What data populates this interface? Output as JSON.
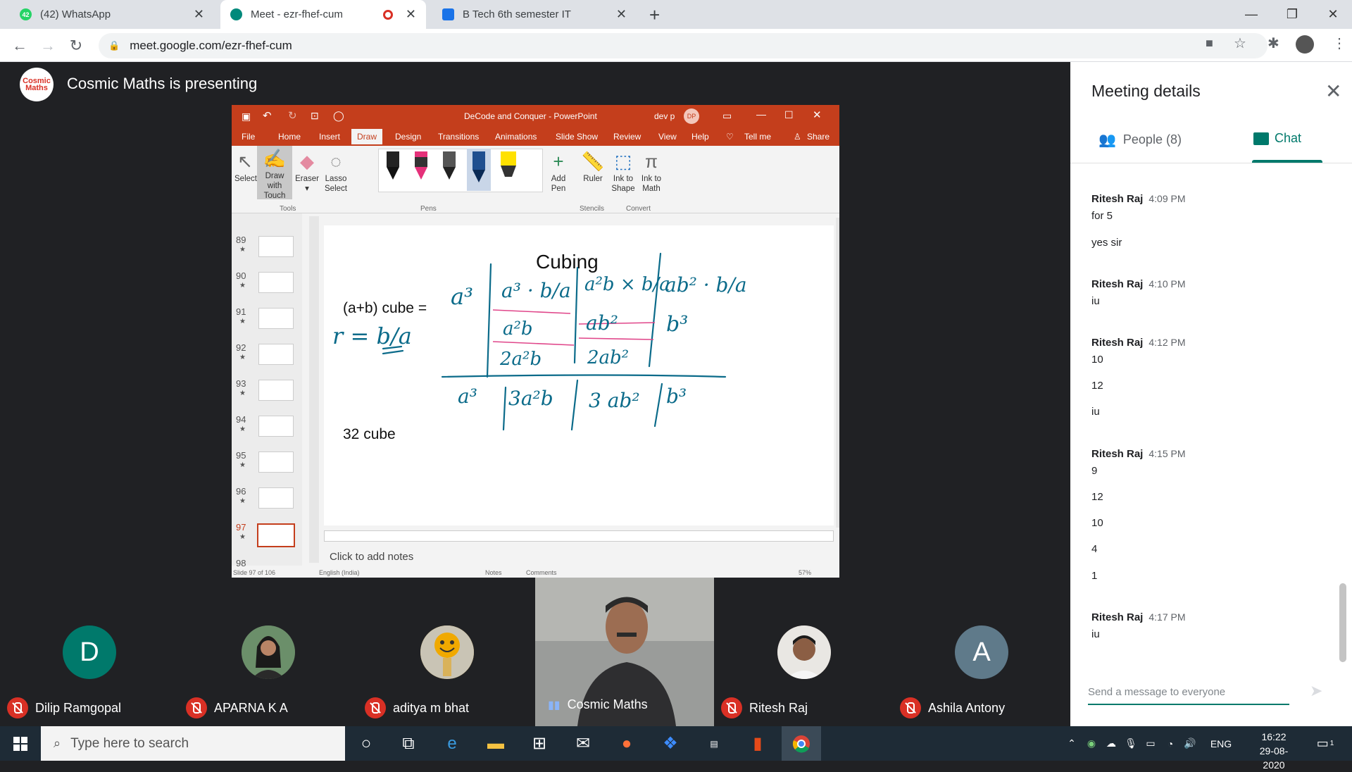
{
  "browser": {
    "tabs": [
      {
        "title": "(42) WhatsApp",
        "badge": "42",
        "active": false
      },
      {
        "title": "Meet - ezr-fhef-cum",
        "active": true
      },
      {
        "title": "B Tech 6th semester IT",
        "active": false
      }
    ],
    "url": "meet.google.com/ezr-fhef-cum"
  },
  "meet": {
    "presenter_logo": "Cosmic Maths",
    "presenting_label": "Cosmic Maths is presenting",
    "panel": {
      "title": "Meeting details",
      "people_tab": "People (8)",
      "chat_tab": "Chat",
      "messages": [
        {
          "name": "Ritesh Raj",
          "time": "4:09 PM",
          "lines": [
            "for 5",
            "yes sir"
          ]
        },
        {
          "name": "Ritesh Raj",
          "time": "4:10 PM",
          "lines": [
            "iu"
          ]
        },
        {
          "name": "Ritesh Raj",
          "time": "4:12 PM",
          "lines": [
            "10",
            "12",
            "iu"
          ]
        },
        {
          "name": "Ritesh Raj",
          "time": "4:15 PM",
          "lines": [
            "9",
            "12",
            "10",
            "4",
            "1"
          ]
        },
        {
          "name": "Ritesh Raj",
          "time": "4:17 PM",
          "lines": [
            "iu"
          ]
        }
      ],
      "send_placeholder": "Send a message to everyone"
    },
    "participants": [
      {
        "name": "Dilip Ramgopal",
        "initial": "D",
        "muted": true,
        "color": "#00796b"
      },
      {
        "name": "APARNA K A",
        "initial": "",
        "muted": true,
        "color": "#3a3a3a"
      },
      {
        "name": "aditya m bhat",
        "initial": "",
        "muted": true,
        "color": "#d4a017"
      },
      {
        "name": "Cosmic Maths",
        "initial": "",
        "muted": false,
        "color": "#8a8d90"
      },
      {
        "name": "Ritesh Raj",
        "initial": "",
        "muted": true,
        "color": "#6d5a4a"
      },
      {
        "name": "Ashila Antony",
        "initial": "A",
        "muted": true,
        "color": "#5f7a8a"
      }
    ]
  },
  "ppt": {
    "title": "DeCode and Conquer  -  PowerPoint",
    "user": "dev p",
    "user_initials": "DP",
    "tabs": [
      "File",
      "Home",
      "Insert",
      "Draw",
      "Design",
      "Transitions",
      "Animations",
      "Slide Show",
      "Review",
      "View",
      "Help",
      "Tell me",
      "Share"
    ],
    "tools": {
      "select": "Select",
      "draw_touch_1": "Draw with",
      "draw_touch_2": "Touch",
      "eraser": "Eraser",
      "lasso_1": "Lasso",
      "lasso_2": "Select",
      "group": "Tools"
    },
    "pens_group": "Pens",
    "add_pen_1": "Add",
    "add_pen_2": "Pen",
    "ruler": "Ruler",
    "stencils_group": "Stencils",
    "ink_shape_1": "Ink to",
    "ink_shape_2": "Shape",
    "ink_math_1": "Ink to",
    "ink_math_2": "Math",
    "convert_group": "Convert",
    "thumbs": [
      "89",
      "90",
      "91",
      "92",
      "93",
      "94",
      "95",
      "96",
      "97",
      "98"
    ],
    "selected_thumb": "97",
    "slide": {
      "title": "Cubing",
      "line1": "(a+b) cube  =",
      "line2": "32 cube",
      "ink": {
        "r1": [
          "a³",
          "a³ · b/a",
          "a²b × b/a",
          "ab² · b/a"
        ],
        "r2": [
          "a²b",
          "ab²",
          "b³"
        ],
        "r3": [
          "2a²b",
          "2ab²"
        ],
        "total": [
          "a³",
          "3a²b",
          "3 ab²",
          "b³"
        ],
        "r_def": "r = b/a"
      }
    },
    "notes_placeholder": "Click to add notes",
    "status": {
      "slide_info": "Slide 97 of 106",
      "language": "English (India)",
      "notes": "Notes",
      "comments": "Comments",
      "zoom": "57%"
    }
  },
  "taskbar": {
    "search_placeholder": "Type here to search",
    "language": "ENG",
    "time": "16:22",
    "date": "29-08-2020",
    "notification_count": "1"
  }
}
